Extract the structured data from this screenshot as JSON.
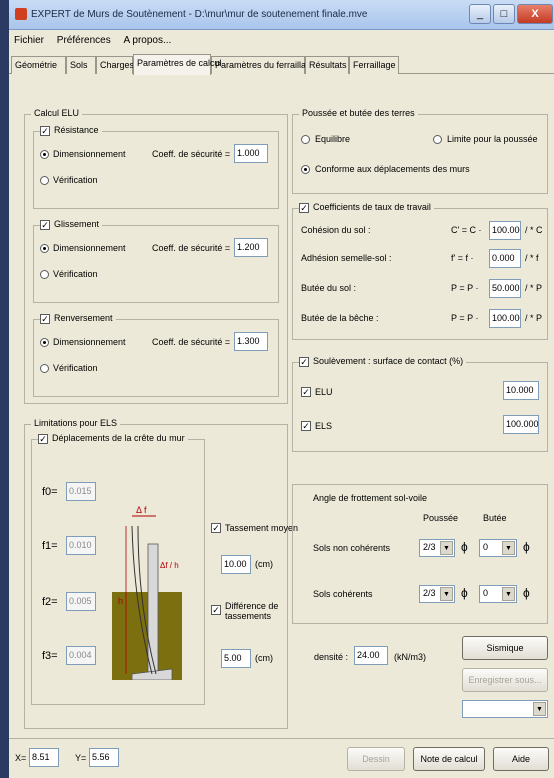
{
  "window": {
    "title": "EXPERT de Murs de Soutènement - D:\\mur\\mur de soutenement finale.mve",
    "min_label": "_",
    "max_label": "□",
    "close_label": "X"
  },
  "menu": [
    "Fichier",
    "Préférences",
    "A propos..."
  ],
  "tabs": [
    "Géométrie",
    "Sols",
    "Charges",
    "Paramètres de calcul",
    "Paramètres du ferraillage",
    "Résultats",
    "Ferraillage"
  ],
  "active_tab": "Paramètres de calcul",
  "calcul_elu": {
    "title": "Calcul ELU",
    "resistance": {
      "label": "Résistance",
      "checked": true,
      "opt1": "Dimensionnement",
      "opt2": "Vérification",
      "coef_label": "Coeff. de sécurité =",
      "coef": "1.000"
    },
    "glissement": {
      "label": "Glissement",
      "checked": true,
      "opt1": "Dimensionnement",
      "opt2": "Vérification",
      "coef_label": "Coeff. de sécurité =",
      "coef": "1.200"
    },
    "renversement": {
      "label": "Renversement",
      "checked": true,
      "opt1": "Dimensionnement",
      "opt2": "Vérification",
      "coef_label": "Coeff. de sécurité =",
      "coef": "1.300"
    }
  },
  "els": {
    "title": "Limitations pour ELS",
    "deplacement_label": "Déplacements de la crête du mur",
    "f0_label": "f0=",
    "f0": "0.015",
    "f1_label": "f1=",
    "f1": "0.010",
    "f2_label": "f2=",
    "f2": "0.005",
    "f3_label": "f3=",
    "f3": "0.004",
    "tassement_moyen_label": "Tassement moyen",
    "tassement_moyen": "10.00",
    "unit_cm": "(cm)",
    "diff_tassement_label": "Différence de tassements",
    "diff_tassement": "5.00",
    "diagram": {
      "delta_f": "Δ f",
      "delta_f_h": "Δf / h",
      "h": "h"
    }
  },
  "poussee": {
    "title": "Poussée et butée des terres",
    "opt_equilibre": "Equilibre",
    "opt_limite": "Limite pour la poussée",
    "opt_conforme": "Conforme aux déplacements des murs"
  },
  "coefficients": {
    "title": "Coefficients de taux de travail",
    "rows": [
      {
        "label": "Cohésion du sol :",
        "sym": "C' = C ·",
        "value": "100.000",
        "unit": "/ * C"
      },
      {
        "label": "Adhésion semelle-sol :",
        "sym": "f' = f ·",
        "value": "0.000",
        "unit": "/ * f"
      },
      {
        "label": "Butée du sol :",
        "sym": "P = P ·",
        "value": "50.000",
        "unit": "/ * P"
      },
      {
        "label": "Butée de la bêche :",
        "sym": "P = P ·",
        "value": "100.000",
        "unit": "/ * P"
      }
    ]
  },
  "soulevement": {
    "title": "Soulèvement : surface de contact (%)",
    "elu_label": "ELU",
    "elu": "10.000",
    "els_label": "ELS",
    "els": "100.000"
  },
  "angle": {
    "title": "Angle de frottement sol-voile",
    "col_poussee": "Poussée",
    "col_butee": "Butée",
    "rows": [
      {
        "label": "Sols non cohérents",
        "poussee": "2/3",
        "butee": "0"
      },
      {
        "label": "Sols cohérents",
        "poussee": "2/3",
        "butee": "0"
      }
    ],
    "phi": "ϕ"
  },
  "densite": {
    "label": "densité :",
    "value": "24.00",
    "unit": "(kN/m3)"
  },
  "buttons": {
    "sismique": "Sismique",
    "enregistrer": "Enregistrer sous...",
    "dessin": "Dessin",
    "note": "Note de calcul",
    "aide": "Aide"
  },
  "status": {
    "x_label": "X=",
    "x": "8.51",
    "y_label": "Y=",
    "y": "5.56"
  },
  "colors": {
    "soil": "#7b6f10",
    "wall": "#d8d8d8",
    "accent_red": "#b00000"
  }
}
